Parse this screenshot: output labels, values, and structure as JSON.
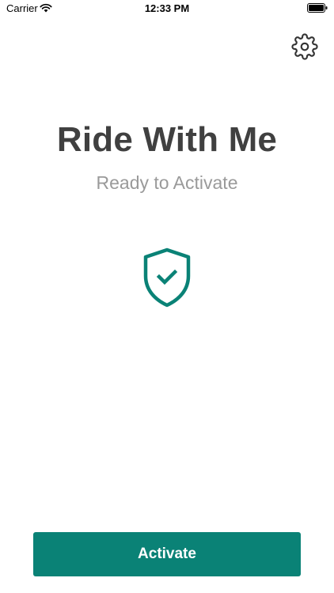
{
  "status_bar": {
    "carrier": "Carrier",
    "time": "12:33 PM",
    "wifi_icon": "wifi-icon",
    "battery_icon": "battery-icon"
  },
  "header": {
    "settings_icon": "gear-icon"
  },
  "main": {
    "title": "Ride With Me",
    "subtitle": "Ready to Activate",
    "status_icon": "shield-check-icon"
  },
  "footer": {
    "activate_label": "Activate"
  },
  "colors": {
    "accent": "#0a8276",
    "title": "#404040",
    "subtitle": "#9a9a9a"
  }
}
